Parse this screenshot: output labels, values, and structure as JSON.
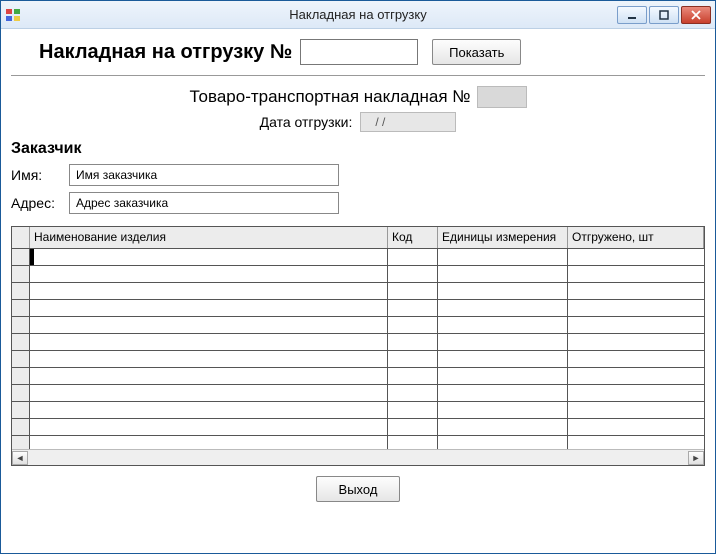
{
  "window": {
    "title": "Накладная на отгрузку"
  },
  "header": {
    "doc_label": "Накладная на отгрузку №",
    "doc_number": "",
    "show_button": "Показать"
  },
  "subheader": {
    "ttn_label": "Товаро-транспортная накладная №",
    "ttn_number": "",
    "date_label": "Дата отгрузки:",
    "date_value": "  /  /"
  },
  "customer": {
    "section_title": "Заказчик",
    "name_label": "Имя:",
    "name_value": "Имя заказчика",
    "address_label": "Адрес:",
    "address_value": "Адрес заказчика"
  },
  "grid": {
    "columns": {
      "name": "Наименование изделия",
      "code": "Код",
      "unit": "Единицы измерения",
      "qty": "Отгружено, шт"
    },
    "row_count": 12
  },
  "footer": {
    "exit_button": "Выход"
  }
}
